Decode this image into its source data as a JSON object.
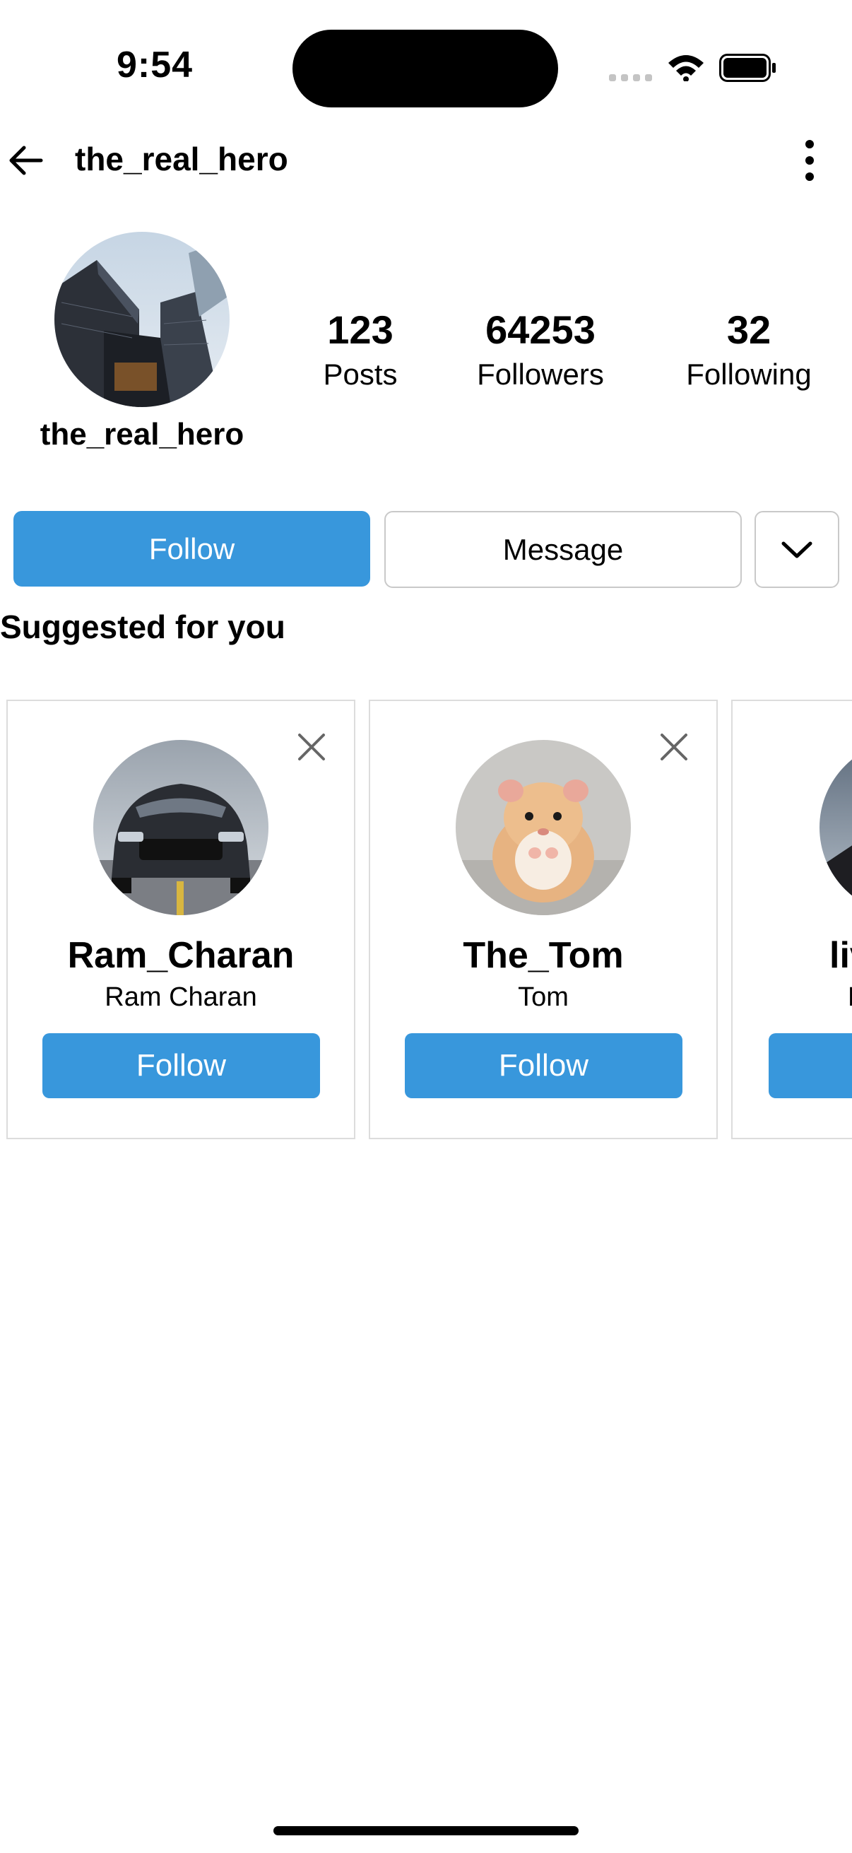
{
  "status_bar": {
    "time": "9:54"
  },
  "header": {
    "title": "the_real_hero"
  },
  "profile": {
    "name": "the_real_hero",
    "stats": [
      {
        "value": "123",
        "label": "Posts"
      },
      {
        "value": "64253",
        "label": "Followers"
      },
      {
        "value": "32",
        "label": "Following"
      }
    ]
  },
  "actions": {
    "follow_label": "Follow",
    "message_label": "Message"
  },
  "suggestions": {
    "title": "Suggested for you",
    "cards": [
      {
        "username": "Ram_Charan",
        "full_name": "Ram Charan",
        "follow_label": "Follow"
      },
      {
        "username": "The_Tom",
        "full_name": "Tom",
        "follow_label": "Follow"
      },
      {
        "username": "liv",
        "full_name": "L",
        "follow_label": ""
      }
    ]
  },
  "colors": {
    "accent": "#3897dc",
    "border": "#c9c9c9"
  },
  "icons": [
    "back-arrow-icon",
    "more-vertical-icon",
    "chevron-down-icon",
    "close-icon",
    "wifi-icon",
    "battery-icon",
    "signal-icon"
  ]
}
